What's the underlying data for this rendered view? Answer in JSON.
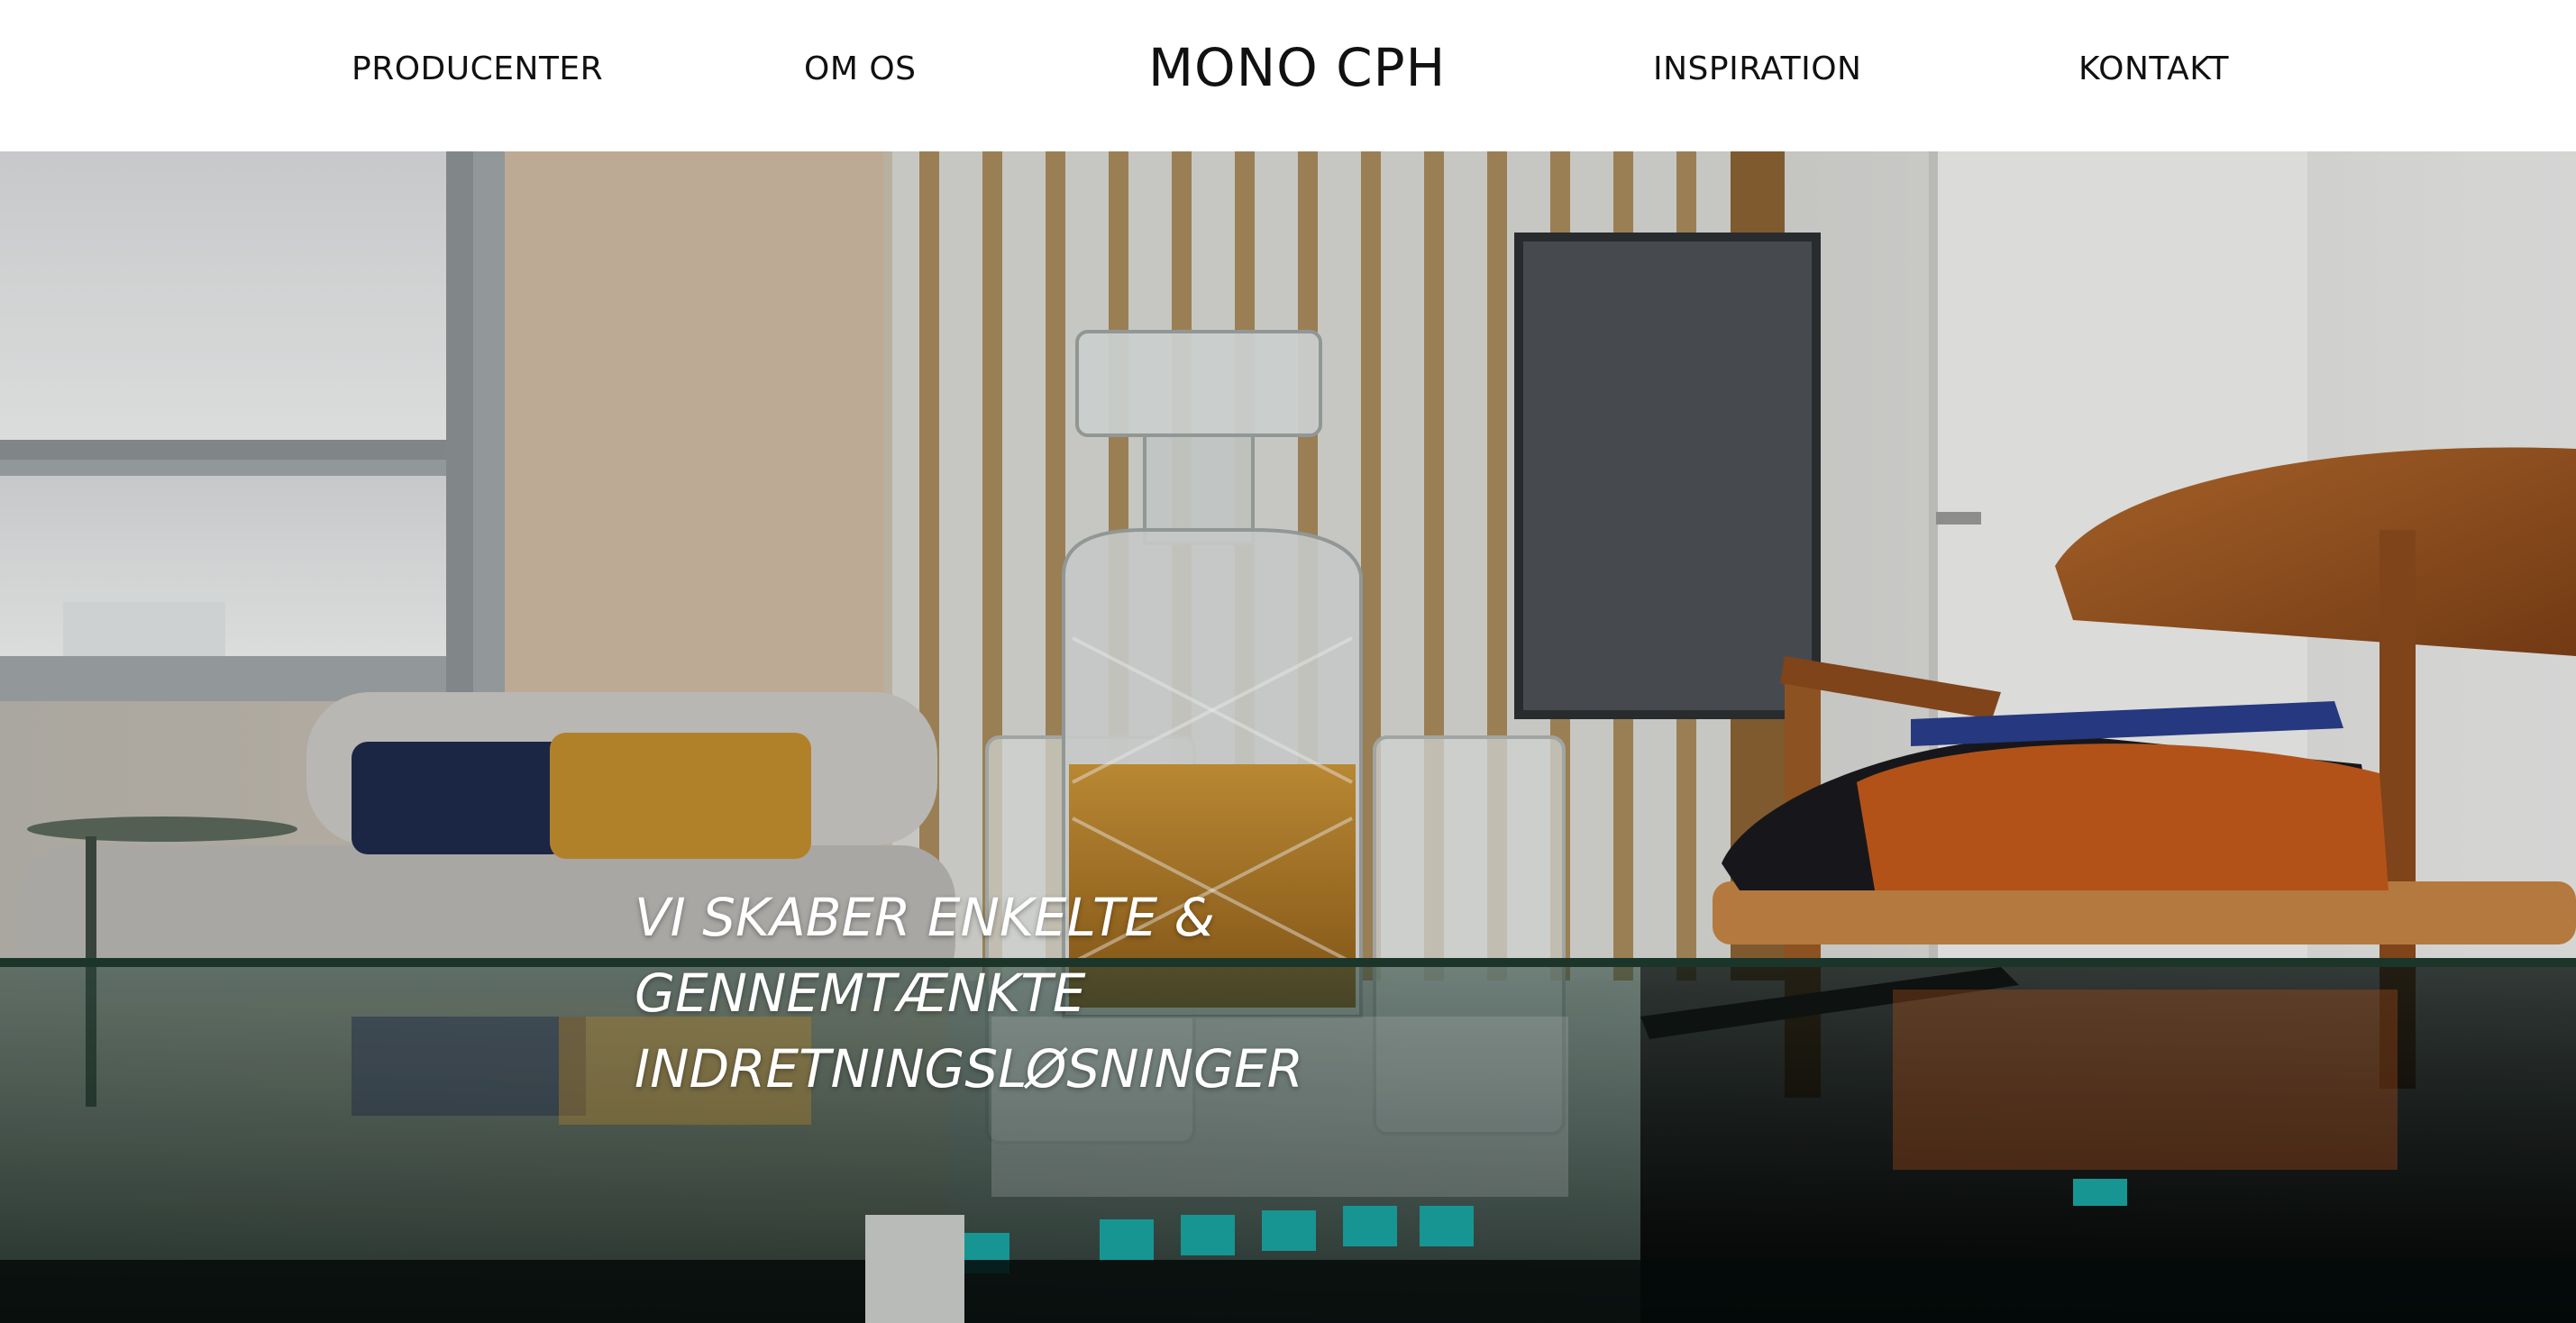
{
  "nav": {
    "left": [
      "PRODUCENTER",
      "OM OS"
    ],
    "brand": "MONO CPH",
    "right": [
      "INSPIRATION",
      "KONTAKT"
    ]
  },
  "hero": {
    "headline_lines": [
      "VI SKABER ENKELTE &",
      "GENNEMTÆNKTE",
      "INDRETNINGSLØSNINGER"
    ]
  }
}
